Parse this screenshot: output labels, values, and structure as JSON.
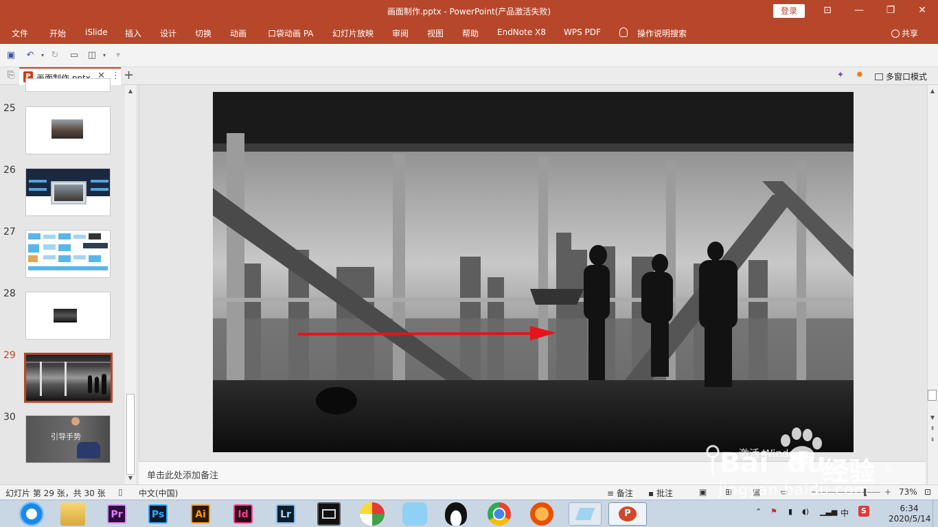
{
  "window": {
    "title": "画面制作.pptx  -  PowerPoint(产品激活失败)",
    "login": "登录",
    "controls": [
      "⊡",
      "—",
      "❐",
      "✕"
    ]
  },
  "menu": {
    "items": [
      "文件",
      "开始",
      "iSlide",
      "插入",
      "设计",
      "切换",
      "动画",
      "口袋动画 PA",
      "幻灯片放映",
      "审阅",
      "视图",
      "帮助",
      "EndNote X8",
      "WPS PDF",
      "操作说明搜索"
    ],
    "share": "共享"
  },
  "tabbar": {
    "doc_tab": "画面制作.pptx",
    "ppt_badge": "P",
    "close": "✕",
    "more": "⋮",
    "add": "+",
    "multi_window": "多窗口模式"
  },
  "slides": {
    "thumbnails": [
      {
        "num": "25"
      },
      {
        "num": "26"
      },
      {
        "num": "27"
      },
      {
        "num": "28"
      },
      {
        "num": "29",
        "active": true
      },
      {
        "num": "30",
        "caption": "引导手势"
      }
    ]
  },
  "notes": {
    "placeholder": "单击此处添加备注"
  },
  "status": {
    "slide_info": "幻灯片 第 29 张，共 30 张",
    "language": "中文(中国)",
    "notes": "备注",
    "comments": "批注",
    "zoom": "73%"
  },
  "watermark": {
    "activate": "激活 Windows",
    "baidu": "Bai",
    "du": "du",
    "jingyan": "经验",
    "url": "jingyan.baidu.com",
    "dot_s": "s."
  },
  "taskbar": {
    "apps": [
      "Pr",
      "Ps",
      "Ai",
      "Id",
      "Lr"
    ],
    "ime": "中",
    "time": "6:34",
    "date": "2020/5/14"
  },
  "colors": {
    "accent": "#b7472a",
    "arrow": "#e8121b"
  }
}
